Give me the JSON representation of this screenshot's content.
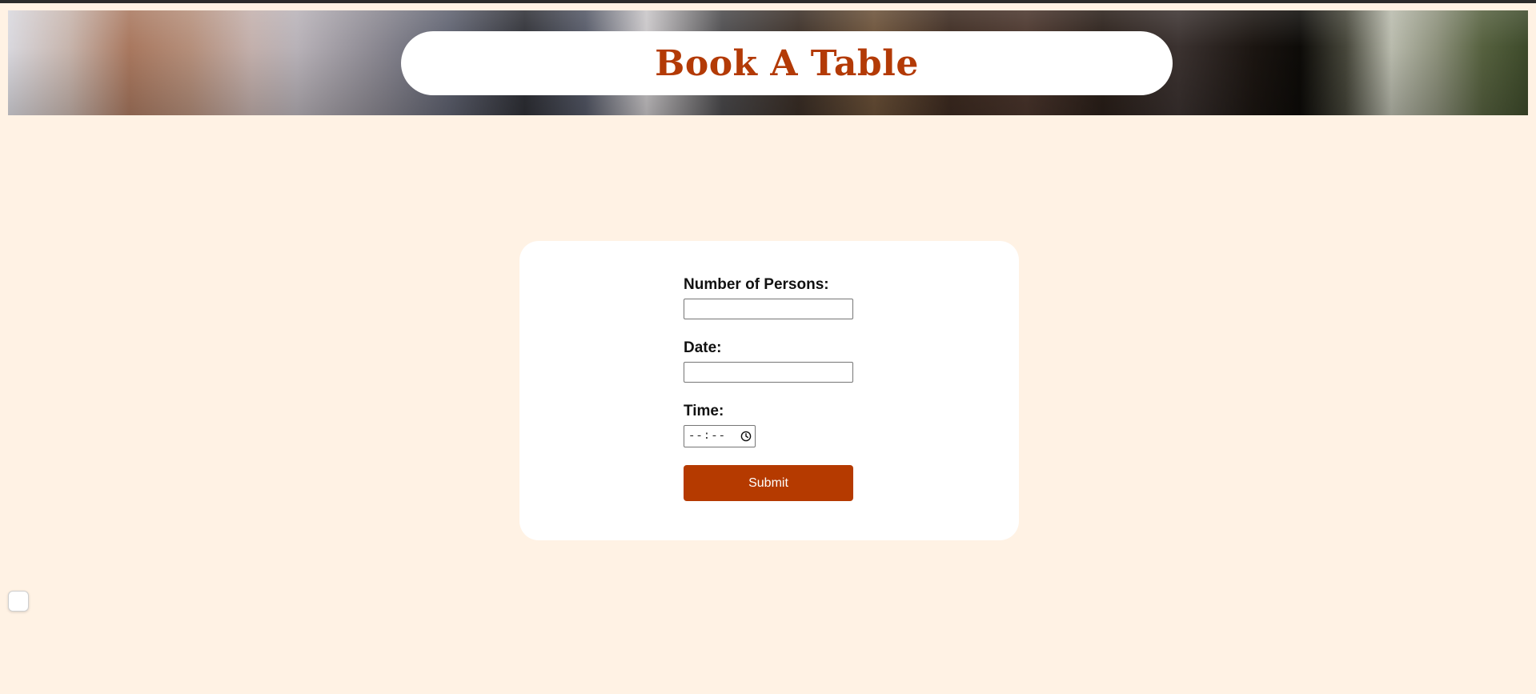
{
  "header": {
    "title": "Book A Table"
  },
  "form": {
    "persons_label": "Number of Persons:",
    "persons_value": "",
    "date_label": "Date:",
    "date_value": "",
    "time_label": "Time:",
    "time_placeholder": "--:--",
    "time_icon": "clock-icon",
    "submit_label": "Submit"
  },
  "colors": {
    "page_background": "#fff2e4",
    "accent": "#b53a00",
    "title": "#b33a06"
  }
}
